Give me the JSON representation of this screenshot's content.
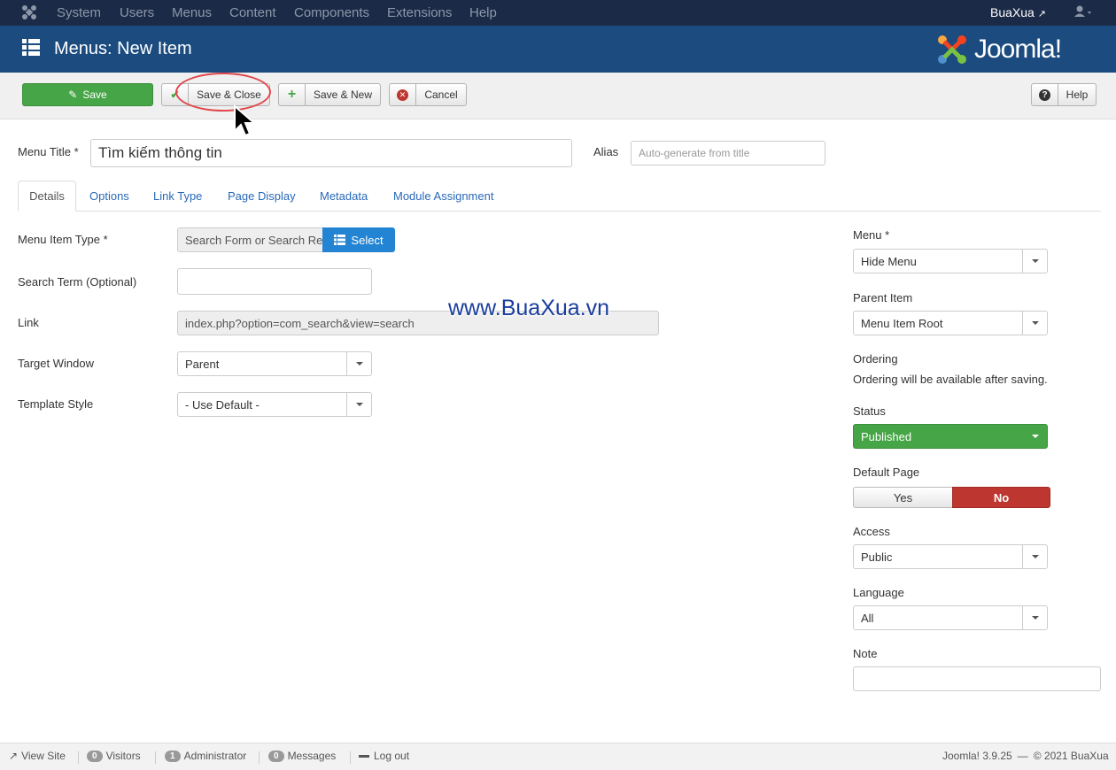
{
  "topnav": {
    "menus": [
      "System",
      "Users",
      "Menus",
      "Content",
      "Components",
      "Extensions",
      "Help"
    ],
    "site_name": "BuaXua"
  },
  "header": {
    "title": "Menus: New Item",
    "logo_text": "Joomla!"
  },
  "toolbar": {
    "save": "Save",
    "save_close": "Save & Close",
    "save_new": "Save & New",
    "cancel": "Cancel",
    "help": "Help"
  },
  "form": {
    "menu_title_label": "Menu Title *",
    "menu_title_value": "Tìm kiếm thông tin",
    "alias_label": "Alias",
    "alias_placeholder": "Auto-generate from title"
  },
  "tabs": [
    "Details",
    "Options",
    "Link Type",
    "Page Display",
    "Metadata",
    "Module Assignment"
  ],
  "details": {
    "menu_item_type_label": "Menu Item Type *",
    "menu_item_type_value": "Search Form or Search Re",
    "select_button": "Select",
    "search_term_label": "Search Term (Optional)",
    "link_label": "Link",
    "link_value": "index.php?option=com_search&view=search",
    "target_window_label": "Target Window",
    "target_window_value": "Parent",
    "template_style_label": "Template Style",
    "template_style_value": "- Use Default -"
  },
  "watermark": "www.BuaXua.vn",
  "sidebar": {
    "menu_label": "Menu *",
    "menu_value": "Hide Menu",
    "parent_label": "Parent Item",
    "parent_value": "Menu Item Root",
    "ordering_label": "Ordering",
    "ordering_text": "Ordering will be available after saving.",
    "status_label": "Status",
    "status_value": "Published",
    "default_label": "Default Page",
    "default_yes": "Yes",
    "default_no": "No",
    "access_label": "Access",
    "access_value": "Public",
    "language_label": "Language",
    "language_value": "All",
    "note_label": "Note"
  },
  "footer": {
    "view_site": "View Site",
    "visitors_count": "0",
    "visitors": "Visitors",
    "admin_count": "1",
    "administrator": "Administrator",
    "messages_count": "0",
    "messages": "Messages",
    "logout": "Log out",
    "version": "Joomla! 3.9.25",
    "copyright": "© 2021 BuaXua"
  },
  "colors": {
    "header_bg": "#1b4b7f",
    "topnav_bg": "#1b2a47",
    "save_green": "#46a546",
    "status_green": "#46a546",
    "no_red": "#bd362f",
    "select_blue": "#2384d3"
  }
}
